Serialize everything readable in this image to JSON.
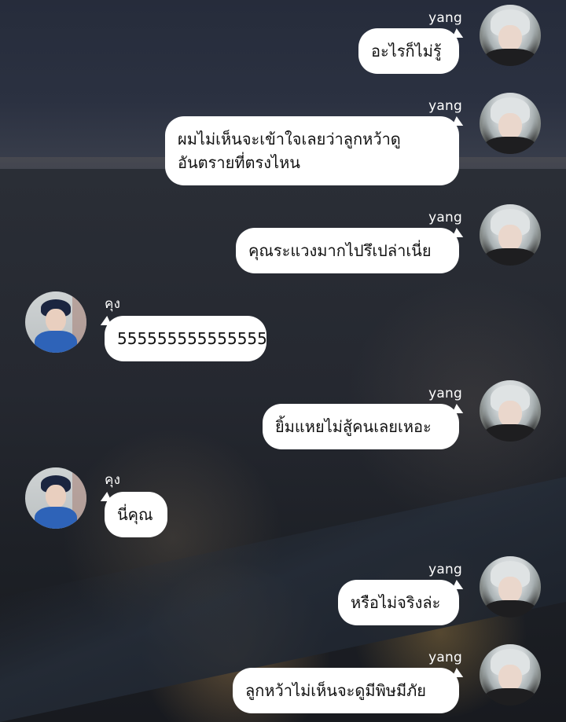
{
  "chat": {
    "messages": [
      {
        "sender": "yang",
        "side": "right",
        "text": "อะไรก็ไม่รู้"
      },
      {
        "sender": "yang",
        "side": "right",
        "text": "ผมไม่เห็นจะเข้าใจเลยว่าลูกหว้าดู\nอันตรายที่ตรงไหน"
      },
      {
        "sender": "yang",
        "side": "right",
        "text": "คุณระแวงมากไปรึเปล่าเนี่ย"
      },
      {
        "sender": "คุง",
        "side": "left",
        "text": "555555555555555"
      },
      {
        "sender": "yang",
        "side": "right",
        "text": "ยิ้มแหยไม่สู้คนเลยเหอะ"
      },
      {
        "sender": "คุง",
        "side": "left",
        "text": "นี่คุณ"
      },
      {
        "sender": "yang",
        "side": "right",
        "text": "หรือไม่จริงล่ะ"
      },
      {
        "sender": "yang",
        "side": "right",
        "text": "ลูกหว้าไม่เห็นจะดูมีพิษมีภัย"
      }
    ]
  },
  "colors": {
    "bubble": "#ffffff",
    "bubble_text": "#111111",
    "name_text": "#ffffff",
    "background": "#1f2433"
  },
  "icons": {
    "yang_avatar": "avatar-silver-hair",
    "kun_avatar": "avatar-blue-suit"
  }
}
